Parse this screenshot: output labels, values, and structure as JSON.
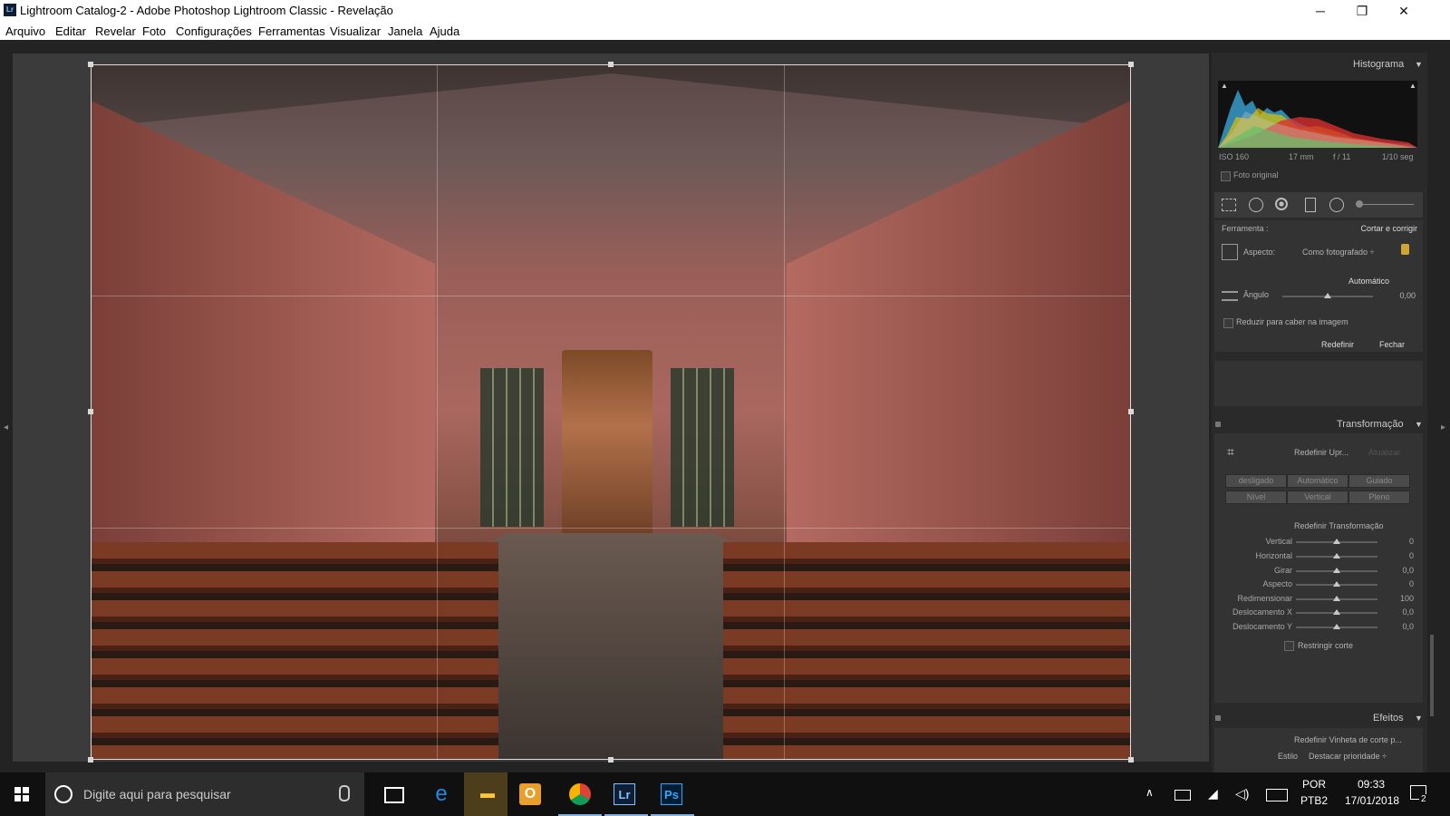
{
  "titlebar": {
    "app_icon_text": "Lr",
    "title": "Lightroom Catalog-2 - Adobe Photoshop Lightroom Classic - Revelação",
    "minimize": "─",
    "restore": "❐",
    "close": "✕"
  },
  "menu": [
    "Arquivo",
    "Editar",
    "Revelar",
    "Foto",
    "Configurações",
    "Ferramentas",
    "Visualizar",
    "Janela",
    "Ajuda"
  ],
  "panels": {
    "histogram": {
      "title": "Histograma",
      "iso": "ISO 160",
      "focal": "17 mm",
      "aperture": "f / 11",
      "shutter": "1/10 seg",
      "original_photo": "Foto original"
    },
    "crop": {
      "tool_label": "Ferramenta :",
      "tool_name": "Cortar e corrigir",
      "aspect_label": "Aspecto:",
      "aspect_value": "Como fotografado ÷",
      "auto": "Automático",
      "angle_label": "Ângulo",
      "angle_value": "0,00",
      "constrain": "Reduzir para caber na imagem",
      "reset": "Redefinir",
      "close": "Fechar"
    },
    "transform": {
      "title": "Transformação",
      "reset_upright": "Redefinir Upr...",
      "update": "Atualizar",
      "buttons_row1": [
        "desligado",
        "Automático",
        "Guiado"
      ],
      "buttons_row2": [
        "Nível",
        "Vertical",
        "Pleno"
      ],
      "reset_transform": "Redefinir Transformação",
      "sliders": [
        {
          "label": "Vertical",
          "value": "0"
        },
        {
          "label": "Horizontal",
          "value": "0"
        },
        {
          "label": "Girar",
          "value": "0,0"
        },
        {
          "label": "Aspecto",
          "value": "0"
        },
        {
          "label": "Redimensionar",
          "value": "100"
        },
        {
          "label": "Deslocamento X",
          "value": "0,0"
        },
        {
          "label": "Deslocamento Y",
          "value": "0,0"
        }
      ],
      "constrain_crop": "Restringir corte"
    },
    "effects": {
      "title": "Efeitos",
      "reset_vignette": "Redefinir Vinheta de corte p...",
      "style_label": "Estilo",
      "style_value": "Destacar prioridade ÷"
    }
  },
  "taskbar": {
    "search_placeholder": "Digite aqui para pesquisar",
    "apps": [
      "edge-icon",
      "file-explorer-icon",
      "outlook-icon",
      "chrome-icon",
      "lightroom-icon",
      "photoshop-icon"
    ],
    "lang": "POR",
    "kbd_layout": "PTB2",
    "time": "09:33",
    "date": "17/01/2018",
    "notifications": "2",
    "lr_label": "Lr",
    "ps_label": "Ps"
  }
}
